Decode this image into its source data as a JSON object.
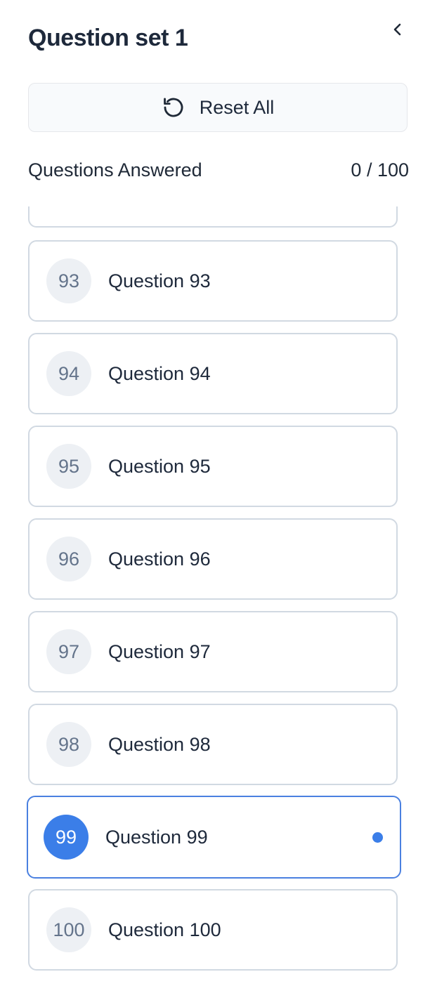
{
  "header": {
    "title": "Question set 1"
  },
  "toolbar": {
    "reset_label": "Reset All",
    "reset_icon": "rotate-ccw-icon",
    "collapse_icon": "chevron-left-icon"
  },
  "progress": {
    "label": "Questions Answered",
    "value": "0 / 100",
    "answered": 0,
    "total": 100
  },
  "questions": [
    {
      "number": "93",
      "label": "Question 93"
    },
    {
      "number": "94",
      "label": "Question 94"
    },
    {
      "number": "95",
      "label": "Question 95"
    },
    {
      "number": "96",
      "label": "Question 96"
    },
    {
      "number": "97",
      "label": "Question 97"
    },
    {
      "number": "98",
      "label": "Question 98"
    },
    {
      "number": "99",
      "label": "Question 99"
    },
    {
      "number": "100",
      "label": "Question 100"
    }
  ],
  "active_question": "99",
  "colors": {
    "accent": "#3b7ee8",
    "border": "#d1d9e2",
    "badge_bg": "#edf0f4"
  }
}
